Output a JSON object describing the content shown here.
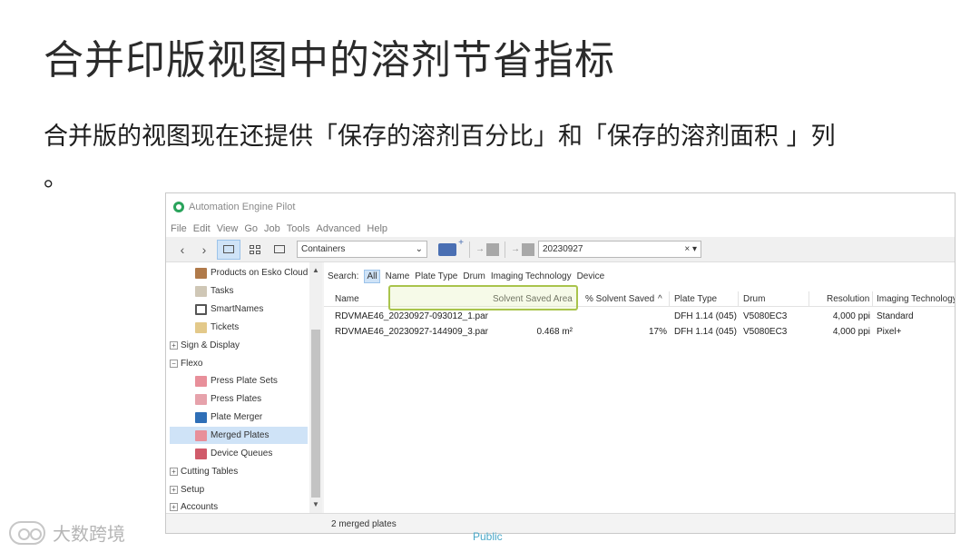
{
  "slide": {
    "title": "合并印版视图中的溶剂节省指标",
    "subtitle_line1": "合并版的视图现在还提供「保存的溶剂百分比」和「保存的溶剂面积 」列",
    "subtitle_line2": "。"
  },
  "window": {
    "title": "Automation Engine Pilot",
    "menu": [
      "File",
      "Edit",
      "View",
      "Go",
      "Job",
      "Tools",
      "Advanced",
      "Help"
    ],
    "toolbar": {
      "back_icon": "chevron-left-icon",
      "forward_icon": "chevron-right-icon",
      "container_select": "Containers",
      "search_value": "20230927",
      "clear_glyph": "×"
    },
    "sidebar": {
      "items": [
        {
          "label": "Products on Esko Cloud",
          "icon": "cloud-products-icon",
          "level": 2,
          "color": "#b07a4a"
        },
        {
          "label": "Tasks",
          "icon": "tasks-icon",
          "level": 2,
          "color": "#9a8f7c"
        },
        {
          "label": "SmartNames",
          "icon": "brackets-icon",
          "level": 2,
          "color": "#555555"
        },
        {
          "label": "Tickets",
          "icon": "tickets-icon",
          "level": 2,
          "color": "#e3c98a"
        },
        {
          "label": "Sign & Display",
          "icon": "",
          "level": 0,
          "expander": "+"
        },
        {
          "label": "Flexo",
          "icon": "",
          "level": 0,
          "expander": "−"
        },
        {
          "label": "Press Plate Sets",
          "icon": "plate-sets-icon",
          "level": 2,
          "color": "#e88f9a"
        },
        {
          "label": "Press Plates",
          "icon": "plates-icon",
          "level": 2,
          "color": "#e6a2ab"
        },
        {
          "label": "Plate Merger",
          "icon": "plate-merger-icon",
          "level": 2,
          "color": "#2f6fb7"
        },
        {
          "label": "Merged Plates",
          "icon": "merged-plates-icon",
          "level": 2,
          "color": "#e88f9a",
          "selected": true
        },
        {
          "label": "Device Queues",
          "icon": "device-queues-icon",
          "level": 2,
          "color": "#d05b6a"
        },
        {
          "label": "Cutting Tables",
          "icon": "",
          "level": 0,
          "expander": "+"
        },
        {
          "label": "Setup",
          "icon": "",
          "level": 0,
          "expander": "+"
        },
        {
          "label": "Accounts",
          "icon": "",
          "level": 0,
          "expander": "+"
        }
      ]
    },
    "search_filters": {
      "label": "Search:",
      "items": [
        "All",
        "Name",
        "Plate Type",
        "Drum",
        "Imaging Technology",
        "Device"
      ]
    },
    "table": {
      "columns": [
        "Name",
        "Solvent Saved Area",
        "% Solvent Saved",
        "Plate Type",
        "Drum",
        "Resolution",
        "Imaging Technology"
      ],
      "sort_glyph": "^",
      "rows": [
        [
          "RDVMAE46_20230927-093012_1.par",
          "",
          "",
          "DFH 1.14 (045)",
          "V5080EC3",
          "4,000 ppi",
          "Standard"
        ],
        [
          "RDVMAE46_20230927-144909_3.par",
          "0.468 m²",
          "17%",
          "DFH 1.14 (045)",
          "V5080EC3",
          "4,000 ppi",
          "Pixel+"
        ]
      ]
    },
    "status": "2 merged plates",
    "highlight_color": "#a9c44c"
  },
  "footer": {
    "public_label": "Public",
    "watermark": "大数跨境"
  }
}
